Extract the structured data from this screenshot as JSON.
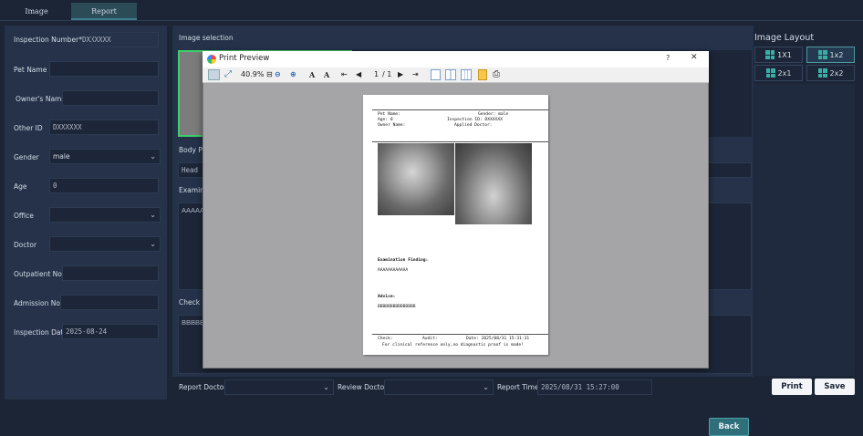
{
  "tabs": [
    {
      "label": "Image",
      "active": false
    },
    {
      "label": "Report",
      "active": true
    }
  ],
  "form": {
    "inspection_number": {
      "label": "Inspection Number*",
      "value": "DXXXXXX"
    },
    "pet_name": {
      "label": "Pet Name",
      "value": ""
    },
    "owner_name": {
      "label": "Owner's Name",
      "value": ""
    },
    "other_id": {
      "label": "Other ID",
      "value": "DXXXXXX"
    },
    "gender": {
      "label": "Gender",
      "value": "male"
    },
    "age": {
      "label": "Age",
      "value": "0"
    },
    "office": {
      "label": "Office",
      "value": ""
    },
    "doctor": {
      "label": "Doctor",
      "value": ""
    },
    "outpatient": {
      "label": "Outpatient No.",
      "value": ""
    },
    "admission": {
      "label": "Admission No.",
      "value": ""
    },
    "inspection_date": {
      "label": "Inspection Date",
      "value": "2025-08-24"
    }
  },
  "middle": {
    "image_selection": "Image selection",
    "body_part_label": "Body Pa",
    "body_part_value": "Head",
    "examination_label": "Examina",
    "examination_value": "AAAAA",
    "check_label": "Check C",
    "check_value": "BBBBB"
  },
  "layout": {
    "title": "Image Layout",
    "buttons": [
      "1X1",
      "1x2",
      "2x1",
      "2x2"
    ],
    "selected": "1x2"
  },
  "bottom": {
    "report_doctor_label": "Report Doctor",
    "report_doctor_value": "",
    "review_doctor_label": "Review Doctor",
    "review_doctor_value": "",
    "report_time_label": "Report Time",
    "report_time_value": "2025/08/31 15:27:00",
    "print_label": "Print",
    "save_label": "Save",
    "back_label": "Back"
  },
  "preview": {
    "title": "Print Preview",
    "help": "?",
    "close": "✕",
    "zoom": "40.9%",
    "page": "1",
    "of": "/ 1",
    "doc": {
      "pet_name": "Pet Name:",
      "gender": "Gender: male",
      "age": "Age: 0",
      "inspection_id": "Inspection ID: DXXXXXX",
      "owner": "Owner Name:",
      "applied": "Applied Doctor:",
      "finding_label": "Examination Finding:",
      "finding_value": "AAAAAAAAAAAA",
      "advice_label": "Advice:",
      "advice_value": "BBBBBBBBBBBBBBB",
      "check": "Check:",
      "audit": "Audit:",
      "date": "Date: 2025/08/31 15:31:31",
      "disclaimer": "For clinical reference only,no diagnostic proof is made!"
    }
  },
  "colors": {
    "accent": "#36b0a3",
    "bg": "#1b2536",
    "panel": "#25324a"
  }
}
